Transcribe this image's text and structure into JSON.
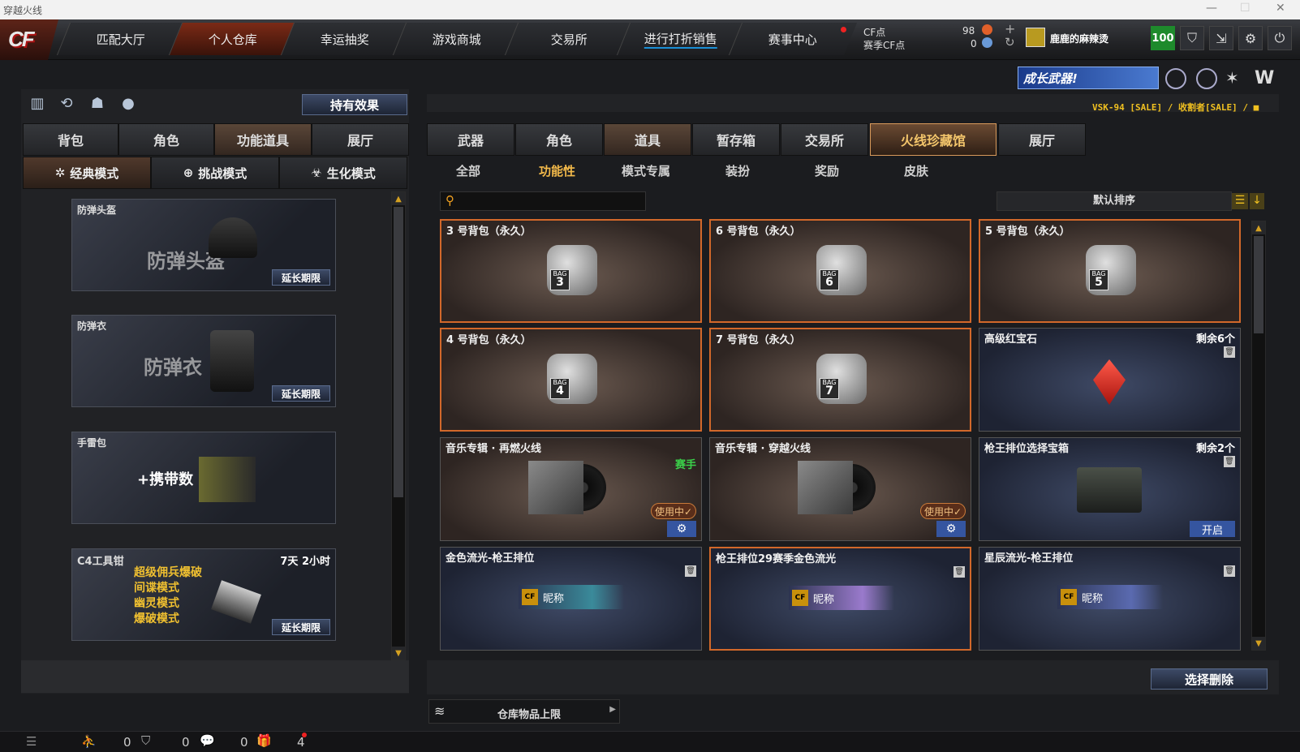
{
  "window": {
    "title": "穿越火线"
  },
  "nav": {
    "tabs": [
      "匹配大厅",
      "个人仓库",
      "幸运抽奖",
      "游戏商城",
      "交易所",
      "进行打折销售",
      "赛事中心"
    ],
    "cf_label": "CF点",
    "season_cf_label": "赛季CF点",
    "cf_value": "98",
    "season_cf_value": "0",
    "username": "鹿鹿的麻辣烫",
    "level": "100"
  },
  "banner": {
    "text": "成长武器!",
    "ticker": "VSK-94 [SALE] / 收割者[SALE] / ■"
  },
  "left": {
    "effects_button": "持有效果",
    "tabs": [
      "背包",
      "角色",
      "功能道具",
      "展厅"
    ],
    "modes": [
      "经典模式",
      "挑战模式",
      "生化模式"
    ],
    "cards": [
      {
        "name": "防弹头盔",
        "big": "防弹头盔",
        "action": "延长期限"
      },
      {
        "name": "防弹衣",
        "big": "防弹衣",
        "action": "延长期限"
      },
      {
        "name": "手雷包",
        "big": "+携带数",
        "action": ""
      },
      {
        "name": "C4工具钳",
        "time": "7天 2小时",
        "lines": [
          "超级佣兵爆破",
          "间谍模式",
          "幽灵模式",
          "爆破模式"
        ],
        "action": "延长期限"
      }
    ]
  },
  "right": {
    "tabs": [
      "武器",
      "角色",
      "道具",
      "暂存箱",
      "交易所",
      "火线珍藏馆",
      "展厅"
    ],
    "subtabs": [
      "全部",
      "功能性",
      "模式专属",
      "装扮",
      "奖励",
      "皮肤"
    ],
    "search_placeholder": "",
    "sort_label": "默认排序",
    "items": [
      {
        "name": "3 号背包（永久）",
        "bag": "3"
      },
      {
        "name": "6 号背包（永久）",
        "bag": "6"
      },
      {
        "name": "5 号背包（永久）",
        "bag": "5"
      },
      {
        "name": "4 号背包（永久）",
        "bag": "4"
      },
      {
        "name": "7 号背包（永久）",
        "bag": "7"
      },
      {
        "name": "高级红宝石",
        "remain": "剩余6个"
      },
      {
        "name": "音乐专辑 · 再燃火线",
        "tag": "赛手",
        "inuse": "使用中✓"
      },
      {
        "name": "音乐专辑 · 穿越火线",
        "inuse": "使用中✓"
      },
      {
        "name": "枪王排位选择宝箱",
        "remain": "剩余2个",
        "open": "开启"
      },
      {
        "name": "金色流光-枪王排位",
        "nick": "昵称"
      },
      {
        "name": "枪王排位29赛季金色流光",
        "nick": "昵称"
      },
      {
        "name": "星辰流光-枪王排位",
        "nick": "昵称"
      }
    ],
    "delete_button": "选择删除",
    "storage_limit": "仓库物品上限"
  },
  "bottom": {
    "c1": "0",
    "c2": "0",
    "c3": "0",
    "c4": "4"
  }
}
